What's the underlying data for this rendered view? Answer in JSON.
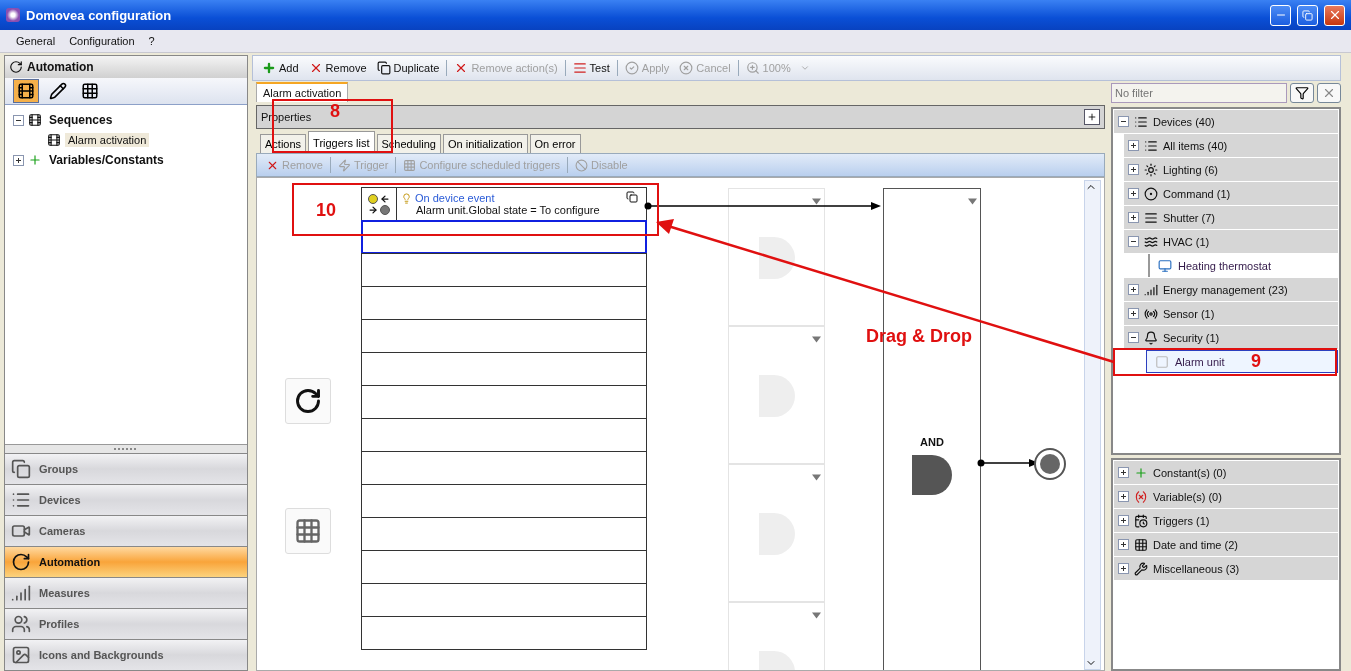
{
  "window": {
    "title": "Domovea configuration"
  },
  "menu": [
    {
      "label": "General"
    },
    {
      "label": "Configuration"
    },
    {
      "label": "?"
    }
  ],
  "left_panel": {
    "title": "Automation",
    "view_buttons": [
      {
        "kind": "sequences",
        "selected": true
      },
      {
        "kind": "editor",
        "selected": false
      },
      {
        "kind": "table",
        "selected": false
      }
    ],
    "tree": [
      {
        "label": "Sequences",
        "kind": "sequences",
        "expanded": true,
        "selected": false,
        "children": [
          {
            "label": "Alarm activation",
            "kind": "sequence",
            "selected": true
          }
        ]
      },
      {
        "label": "Variables/Constants",
        "kind": "variables",
        "expanded": false,
        "selected": false
      }
    ],
    "nav": [
      {
        "label": "Groups",
        "kind": "groups",
        "selected": false
      },
      {
        "label": "Devices",
        "kind": "devices",
        "selected": false
      },
      {
        "label": "Cameras",
        "kind": "cameras",
        "selected": false
      },
      {
        "label": "Automation",
        "kind": "automation",
        "selected": true
      },
      {
        "label": "Measures",
        "kind": "measures",
        "selected": false
      },
      {
        "label": "Profiles",
        "kind": "profiles",
        "selected": false
      },
      {
        "label": "Icons and Backgrounds",
        "kind": "icons",
        "selected": false
      }
    ]
  },
  "toolbar": [
    {
      "label": "Add",
      "kind": "add",
      "disabled": false
    },
    {
      "label": "Remove",
      "kind": "remove",
      "disabled": false
    },
    {
      "label": "Duplicate",
      "kind": "duplicate",
      "disabled": false
    },
    {
      "label": "Remove action(s)",
      "kind": "remove",
      "disabled": true
    },
    {
      "label": "Test",
      "kind": "test",
      "disabled": false
    },
    {
      "label": "Apply",
      "kind": "apply",
      "disabled": true
    },
    {
      "label": "Cancel",
      "kind": "cancel",
      "disabled": true
    },
    {
      "label": "100%",
      "kind": "zoom",
      "disabled": true
    }
  ],
  "document_tab": {
    "label": "Alarm activation",
    "selected": true
  },
  "properties": {
    "label": "Properties"
  },
  "sub_tabs": [
    {
      "label": "Actions",
      "selected": false
    },
    {
      "label": "Triggers list",
      "selected": true
    },
    {
      "label": "Scheduling",
      "selected": false
    },
    {
      "label": "On initialization",
      "selected": false
    },
    {
      "label": "On error",
      "selected": false
    }
  ],
  "sub_toolbar": [
    {
      "label": "Remove",
      "kind": "remove",
      "disabled": true
    },
    {
      "label": "Trigger",
      "kind": "trigger",
      "disabled": true
    },
    {
      "label": "Configure scheduled triggers",
      "kind": "schedule",
      "disabled": true
    },
    {
      "label": "Disable",
      "kind": "disable",
      "disabled": true
    }
  ],
  "slots": [
    {
      "kind": "trigger",
      "title": "On device event",
      "condition": "Alarm unit.Global state = To configure",
      "selected": false
    },
    {
      "kind": "empty",
      "selected": true
    },
    {
      "kind": "empty",
      "selected": false
    },
    {
      "kind": "empty",
      "selected": false
    },
    {
      "kind": "empty",
      "selected": false
    },
    {
      "kind": "empty",
      "selected": false
    },
    {
      "kind": "empty",
      "selected": false
    },
    {
      "kind": "empty",
      "selected": false
    },
    {
      "kind": "empty",
      "selected": false
    },
    {
      "kind": "empty",
      "selected": false
    },
    {
      "kind": "empty",
      "selected": false
    },
    {
      "kind": "empty",
      "selected": false
    },
    {
      "kind": "empty",
      "selected": false
    },
    {
      "kind": "empty",
      "selected": false
    }
  ],
  "gate": {
    "label": "AND"
  },
  "filter": {
    "placeholder": "No filter"
  },
  "device_tree": [
    {
      "label": "Devices (40)",
      "kind": "devices",
      "expanded": true,
      "children": [
        {
          "label": "All items (40)",
          "kind": "devices",
          "expanded": false
        },
        {
          "label": "Lighting (6)",
          "kind": "lighting",
          "expanded": false
        },
        {
          "label": "Command (1)",
          "kind": "command",
          "expanded": false
        },
        {
          "label": "Shutter (7)",
          "kind": "shutter",
          "expanded": false
        },
        {
          "label": "HVAC (1)",
          "kind": "hvac",
          "expanded": true,
          "children": [
            {
              "label": "Heating thermostat",
              "kind": "thermostat",
              "selected": false
            }
          ]
        },
        {
          "label": "Energy management (23)",
          "kind": "energy",
          "expanded": false
        },
        {
          "label": "Sensor (1)",
          "kind": "sensor",
          "expanded": false
        },
        {
          "label": "Security (1)",
          "kind": "security",
          "expanded": true,
          "children": [
            {
              "label": "Alarm unit",
              "kind": "alarm",
              "selected": true
            }
          ]
        }
      ]
    }
  ],
  "other_tree": [
    {
      "label": "Constant(s) (0)",
      "kind": "constant",
      "expanded": false
    },
    {
      "label": "Variable(s) (0)",
      "kind": "variable",
      "expanded": false
    },
    {
      "label": "Triggers (1)",
      "kind": "triggers",
      "expanded": false
    },
    {
      "label": "Date and time (2)",
      "kind": "date",
      "expanded": false
    },
    {
      "label": "Miscellaneous (3)",
      "kind": "misc",
      "expanded": false
    }
  ],
  "annotations": [
    {
      "label": "8"
    },
    {
      "label": "10"
    },
    {
      "label": "9"
    },
    {
      "label": "Drag & Drop"
    }
  ]
}
